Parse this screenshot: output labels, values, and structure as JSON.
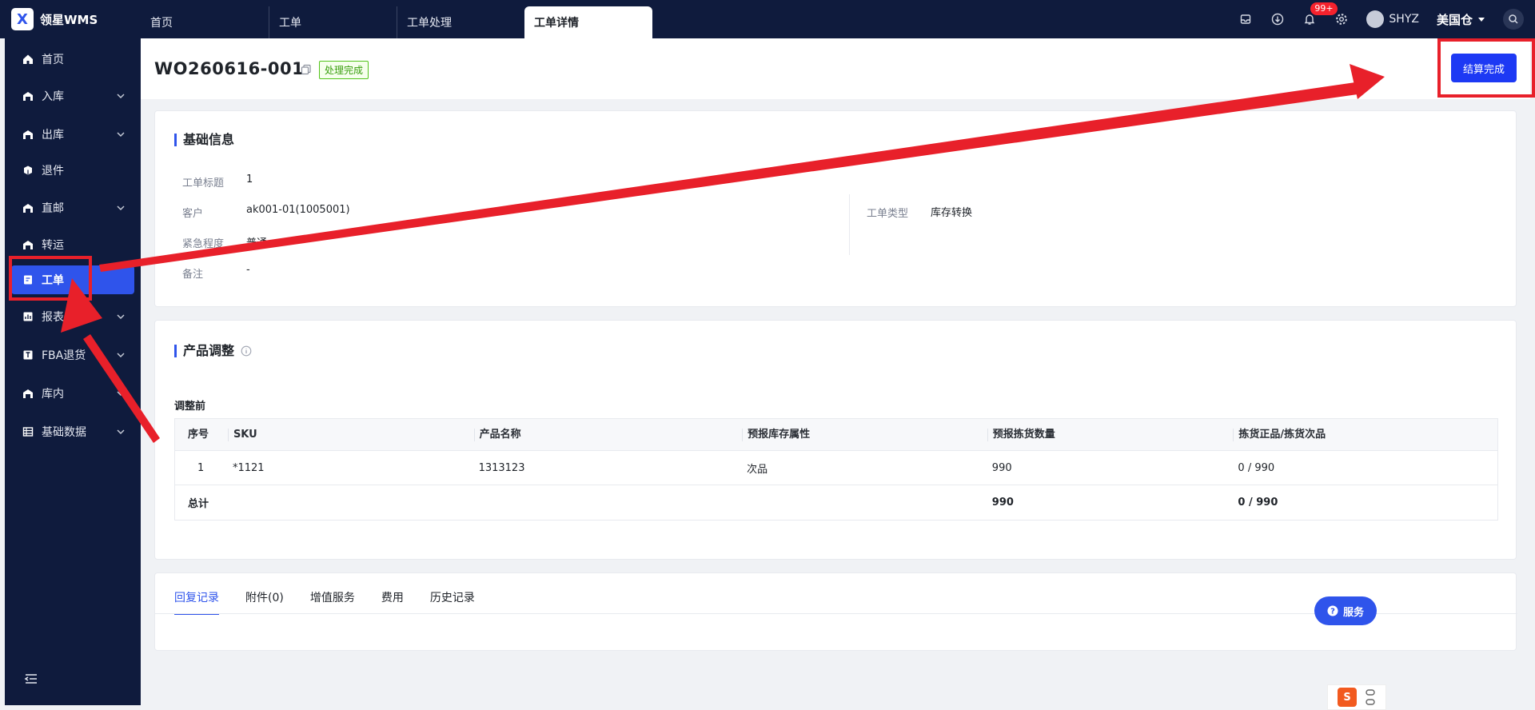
{
  "app": {
    "brand": "领星WMS",
    "logo_glyph": "X"
  },
  "tabs": [
    {
      "label": "首页"
    },
    {
      "label": "工单"
    },
    {
      "label": "工单处理"
    },
    {
      "label": "工单详情",
      "active": true
    }
  ],
  "topbar": {
    "notifications": "99+",
    "user": "SHYZ",
    "warehouse": "美国仓"
  },
  "sidebar": [
    {
      "label": "首页",
      "icon": "home-icon"
    },
    {
      "label": "入库",
      "icon": "inbound-icon",
      "expandable": true
    },
    {
      "label": "出库",
      "icon": "outbound-icon",
      "expandable": true
    },
    {
      "label": "退件",
      "icon": "return-icon"
    },
    {
      "label": "直邮",
      "icon": "mail-icon",
      "expandable": true
    },
    {
      "label": "转运",
      "icon": "transfer-icon"
    },
    {
      "label": "工单",
      "icon": "workorder-icon",
      "active": true
    },
    {
      "label": "报表",
      "icon": "report-icon",
      "expandable": true
    },
    {
      "label": "FBA退货",
      "icon": "fba-icon",
      "expandable": true
    },
    {
      "label": "库内",
      "icon": "warehouse-icon",
      "expandable": true
    },
    {
      "label": "基础数据",
      "icon": "grid-icon",
      "expandable": true
    }
  ],
  "header": {
    "title": "WO260616-001",
    "status": "处理完成",
    "settle_button": "结算完成"
  },
  "basic": {
    "title": "基础信息",
    "fields": [
      {
        "label": "工单标题",
        "value": "1"
      },
      {
        "label": "客户",
        "value": "ak001-01(1005001)"
      },
      {
        "label": "紧急程度",
        "value": "普通"
      },
      {
        "label": "备注",
        "value": "-"
      }
    ],
    "type_label": "工单类型",
    "type_value": "库存转换"
  },
  "product": {
    "title": "产品调整",
    "subtitle": "调整前",
    "columns": [
      "序号",
      "SKU",
      "产品名称",
      "预报库存属性",
      "预报拣货数量",
      "拣货正品/拣货次品"
    ],
    "rows": [
      [
        "1",
        "*1121",
        "1313123",
        "次品",
        "990",
        "0 / 990"
      ]
    ],
    "total": {
      "label": "总计",
      "qty": "990",
      "pick": "0 / 990"
    }
  },
  "record_tabs": [
    "回复记录",
    "附件(0)",
    "增值服务",
    "费用",
    "历史记录"
  ],
  "service_button": "服务",
  "ime_logo": "S",
  "annotation_color": "#e8202a"
}
